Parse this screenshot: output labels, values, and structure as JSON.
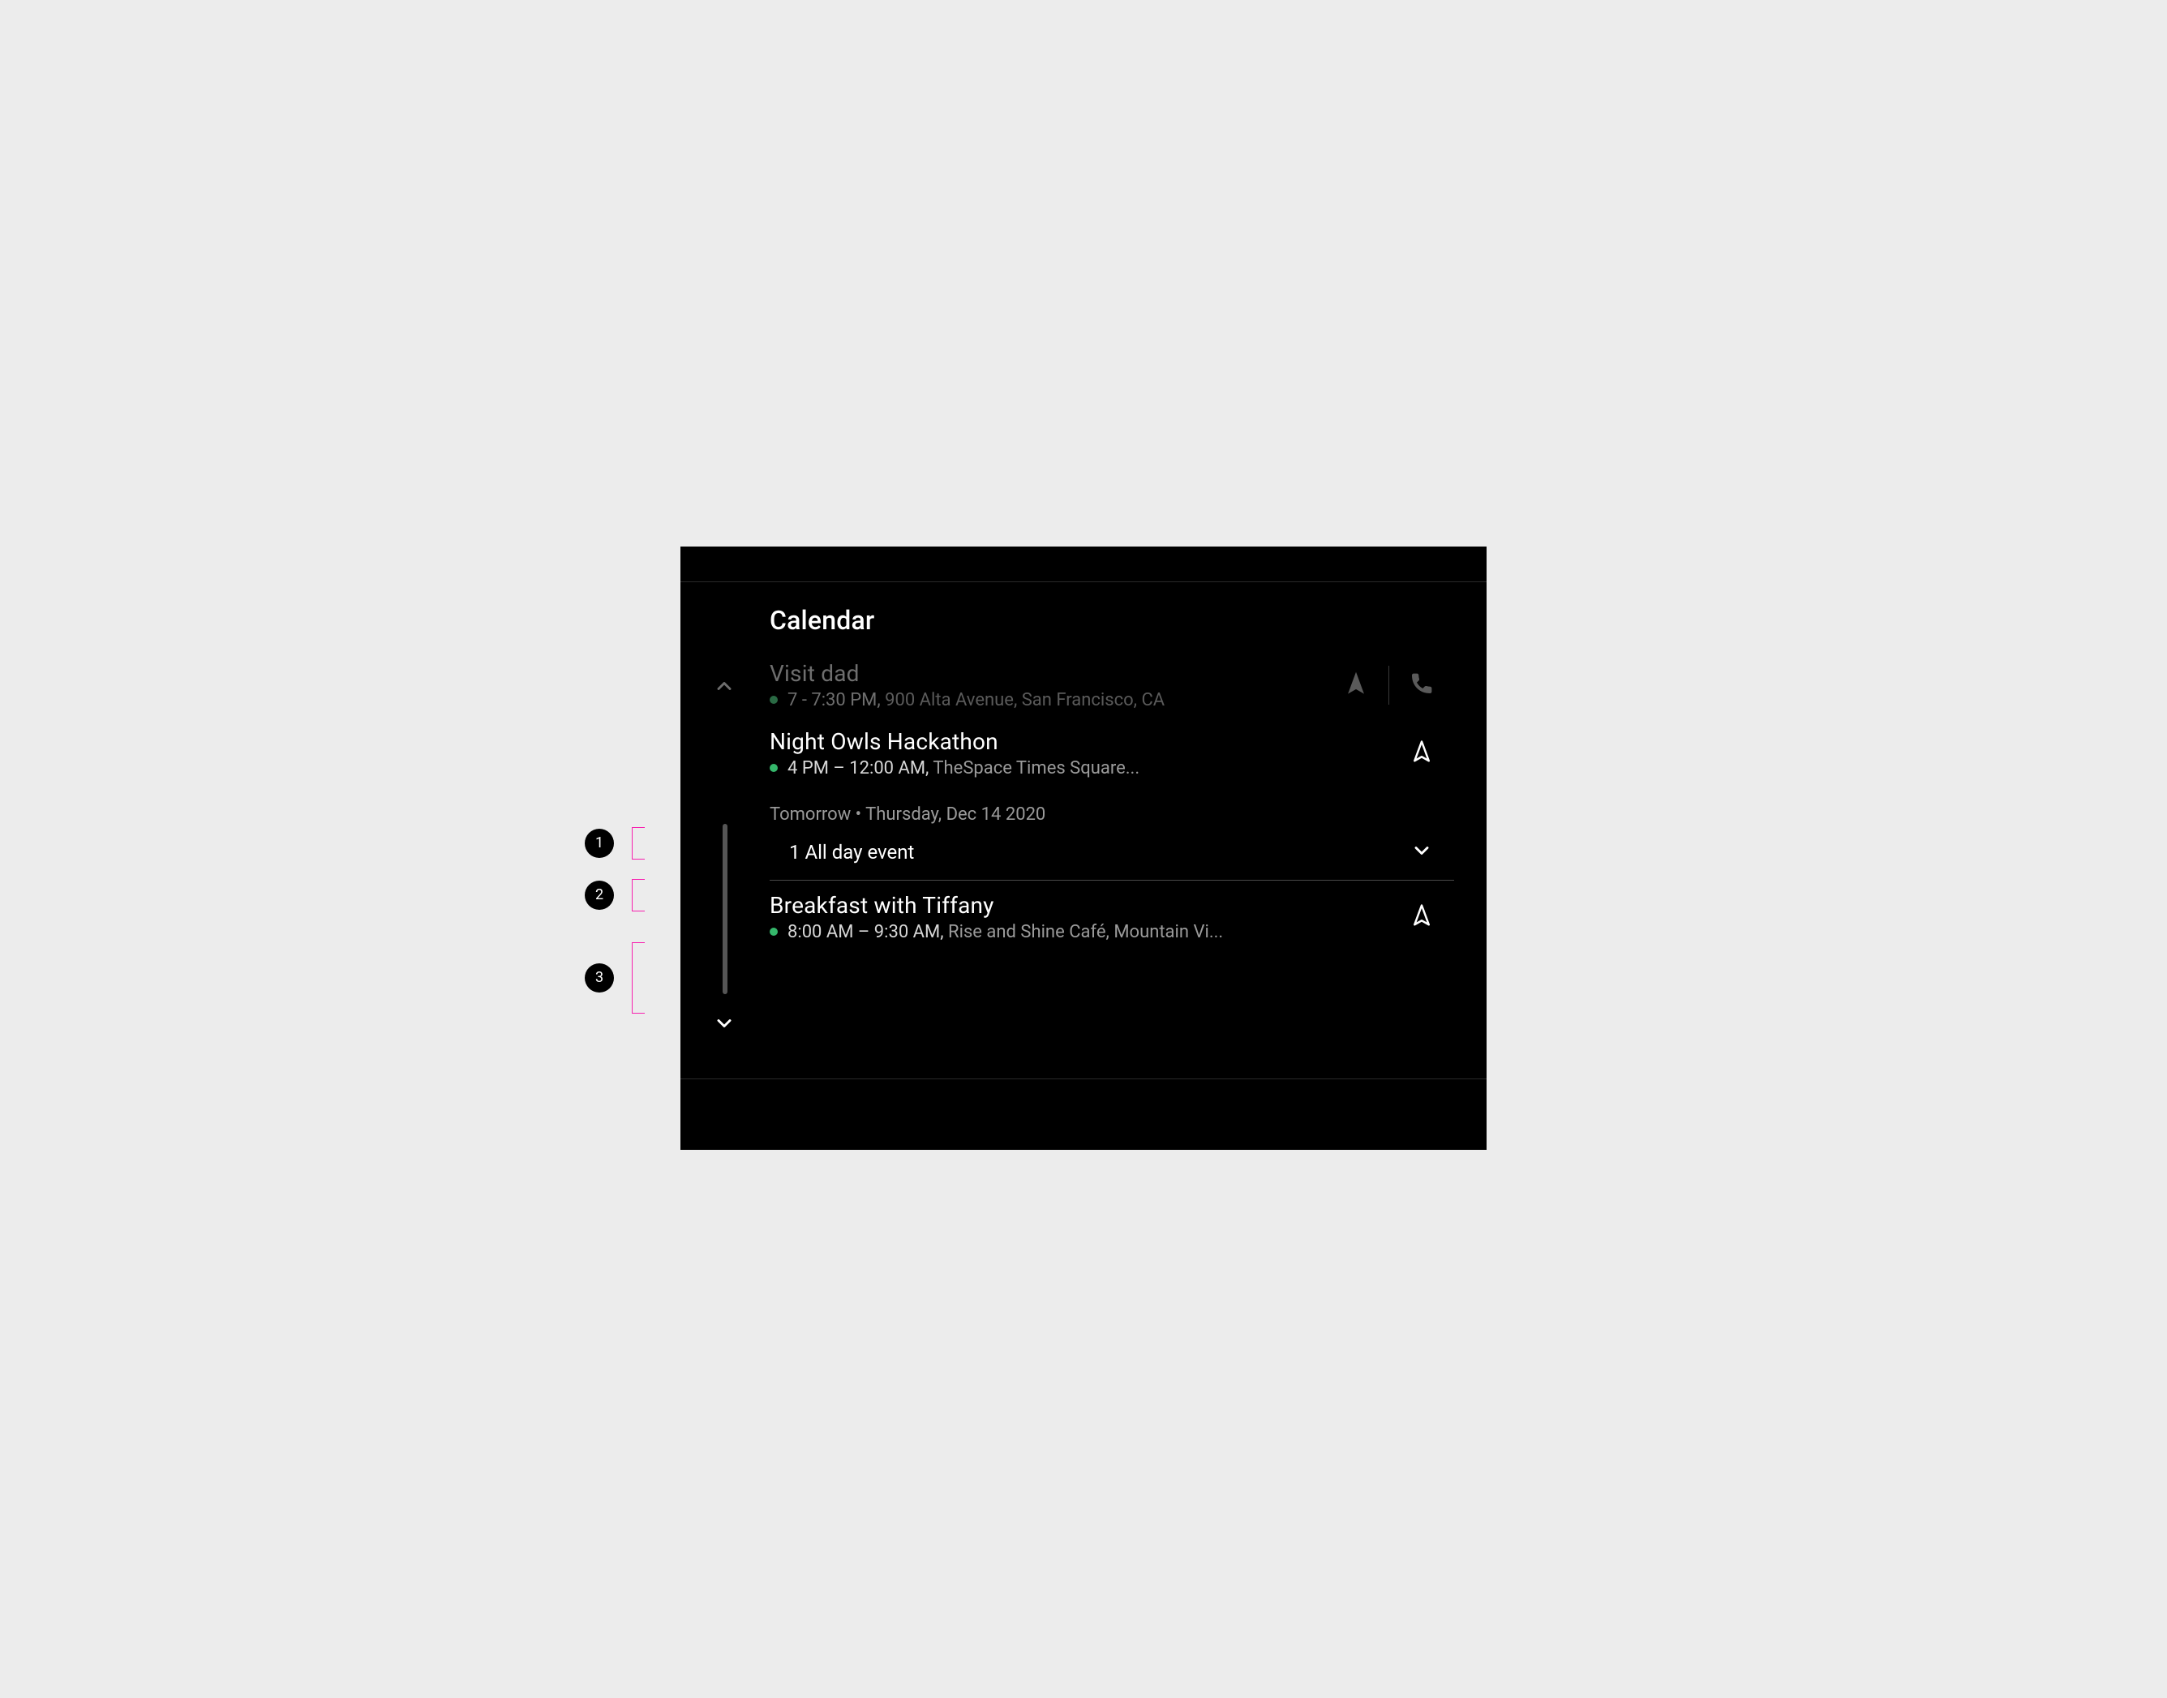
{
  "app": {
    "title": "Calendar"
  },
  "events": [
    {
      "title": "Visit dad",
      "time": "7 - 7:30 PM,",
      "location": "900 Alta Avenue, San Francisco, CA",
      "dimmed": true,
      "has_nav": true,
      "has_call": true
    },
    {
      "title": "Night Owls Hackathon",
      "time": "4 PM – 12:00 AM,",
      "location": "TheSpace Times Square...",
      "dimmed": false,
      "has_nav": true,
      "has_call": false
    }
  ],
  "section": {
    "header": "Tomorrow • Thursday, Dec 14 2020"
  },
  "allday": {
    "label": "1 All day event"
  },
  "events2": [
    {
      "title": "Breakfast with Tiffany",
      "time": "8:00 AM – 9:30 AM,",
      "location": "Rise and Shine Café, Mountain Vi...",
      "dimmed": false,
      "has_nav": true,
      "has_call": false
    }
  ],
  "annotations": [
    {
      "n": "1"
    },
    {
      "n": "2"
    },
    {
      "n": "3"
    }
  ],
  "colors": {
    "accent_green": "#35B76B",
    "annotation_pink": "#F71FAF"
  }
}
